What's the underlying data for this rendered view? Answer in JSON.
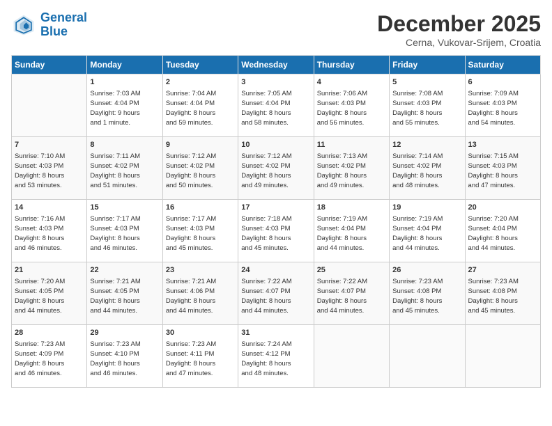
{
  "header": {
    "logo_line1": "General",
    "logo_line2": "Blue",
    "month": "December 2025",
    "location": "Cerna, Vukovar-Srijem, Croatia"
  },
  "weekdays": [
    "Sunday",
    "Monday",
    "Tuesday",
    "Wednesday",
    "Thursday",
    "Friday",
    "Saturday"
  ],
  "weeks": [
    [
      {
        "day": "",
        "info": ""
      },
      {
        "day": "1",
        "info": "Sunrise: 7:03 AM\nSunset: 4:04 PM\nDaylight: 9 hours\nand 1 minute."
      },
      {
        "day": "2",
        "info": "Sunrise: 7:04 AM\nSunset: 4:04 PM\nDaylight: 8 hours\nand 59 minutes."
      },
      {
        "day": "3",
        "info": "Sunrise: 7:05 AM\nSunset: 4:04 PM\nDaylight: 8 hours\nand 58 minutes."
      },
      {
        "day": "4",
        "info": "Sunrise: 7:06 AM\nSunset: 4:03 PM\nDaylight: 8 hours\nand 56 minutes."
      },
      {
        "day": "5",
        "info": "Sunrise: 7:08 AM\nSunset: 4:03 PM\nDaylight: 8 hours\nand 55 minutes."
      },
      {
        "day": "6",
        "info": "Sunrise: 7:09 AM\nSunset: 4:03 PM\nDaylight: 8 hours\nand 54 minutes."
      }
    ],
    [
      {
        "day": "7",
        "info": "Sunrise: 7:10 AM\nSunset: 4:03 PM\nDaylight: 8 hours\nand 53 minutes."
      },
      {
        "day": "8",
        "info": "Sunrise: 7:11 AM\nSunset: 4:02 PM\nDaylight: 8 hours\nand 51 minutes."
      },
      {
        "day": "9",
        "info": "Sunrise: 7:12 AM\nSunset: 4:02 PM\nDaylight: 8 hours\nand 50 minutes."
      },
      {
        "day": "10",
        "info": "Sunrise: 7:12 AM\nSunset: 4:02 PM\nDaylight: 8 hours\nand 49 minutes."
      },
      {
        "day": "11",
        "info": "Sunrise: 7:13 AM\nSunset: 4:02 PM\nDaylight: 8 hours\nand 49 minutes."
      },
      {
        "day": "12",
        "info": "Sunrise: 7:14 AM\nSunset: 4:02 PM\nDaylight: 8 hours\nand 48 minutes."
      },
      {
        "day": "13",
        "info": "Sunrise: 7:15 AM\nSunset: 4:03 PM\nDaylight: 8 hours\nand 47 minutes."
      }
    ],
    [
      {
        "day": "14",
        "info": "Sunrise: 7:16 AM\nSunset: 4:03 PM\nDaylight: 8 hours\nand 46 minutes."
      },
      {
        "day": "15",
        "info": "Sunrise: 7:17 AM\nSunset: 4:03 PM\nDaylight: 8 hours\nand 46 minutes."
      },
      {
        "day": "16",
        "info": "Sunrise: 7:17 AM\nSunset: 4:03 PM\nDaylight: 8 hours\nand 45 minutes."
      },
      {
        "day": "17",
        "info": "Sunrise: 7:18 AM\nSunset: 4:03 PM\nDaylight: 8 hours\nand 45 minutes."
      },
      {
        "day": "18",
        "info": "Sunrise: 7:19 AM\nSunset: 4:04 PM\nDaylight: 8 hours\nand 44 minutes."
      },
      {
        "day": "19",
        "info": "Sunrise: 7:19 AM\nSunset: 4:04 PM\nDaylight: 8 hours\nand 44 minutes."
      },
      {
        "day": "20",
        "info": "Sunrise: 7:20 AM\nSunset: 4:04 PM\nDaylight: 8 hours\nand 44 minutes."
      }
    ],
    [
      {
        "day": "21",
        "info": "Sunrise: 7:20 AM\nSunset: 4:05 PM\nDaylight: 8 hours\nand 44 minutes."
      },
      {
        "day": "22",
        "info": "Sunrise: 7:21 AM\nSunset: 4:05 PM\nDaylight: 8 hours\nand 44 minutes."
      },
      {
        "day": "23",
        "info": "Sunrise: 7:21 AM\nSunset: 4:06 PM\nDaylight: 8 hours\nand 44 minutes."
      },
      {
        "day": "24",
        "info": "Sunrise: 7:22 AM\nSunset: 4:07 PM\nDaylight: 8 hours\nand 44 minutes."
      },
      {
        "day": "25",
        "info": "Sunrise: 7:22 AM\nSunset: 4:07 PM\nDaylight: 8 hours\nand 44 minutes."
      },
      {
        "day": "26",
        "info": "Sunrise: 7:23 AM\nSunset: 4:08 PM\nDaylight: 8 hours\nand 45 minutes."
      },
      {
        "day": "27",
        "info": "Sunrise: 7:23 AM\nSunset: 4:08 PM\nDaylight: 8 hours\nand 45 minutes."
      }
    ],
    [
      {
        "day": "28",
        "info": "Sunrise: 7:23 AM\nSunset: 4:09 PM\nDaylight: 8 hours\nand 46 minutes."
      },
      {
        "day": "29",
        "info": "Sunrise: 7:23 AM\nSunset: 4:10 PM\nDaylight: 8 hours\nand 46 minutes."
      },
      {
        "day": "30",
        "info": "Sunrise: 7:23 AM\nSunset: 4:11 PM\nDaylight: 8 hours\nand 47 minutes."
      },
      {
        "day": "31",
        "info": "Sunrise: 7:24 AM\nSunset: 4:12 PM\nDaylight: 8 hours\nand 48 minutes."
      },
      {
        "day": "",
        "info": ""
      },
      {
        "day": "",
        "info": ""
      },
      {
        "day": "",
        "info": ""
      }
    ]
  ]
}
